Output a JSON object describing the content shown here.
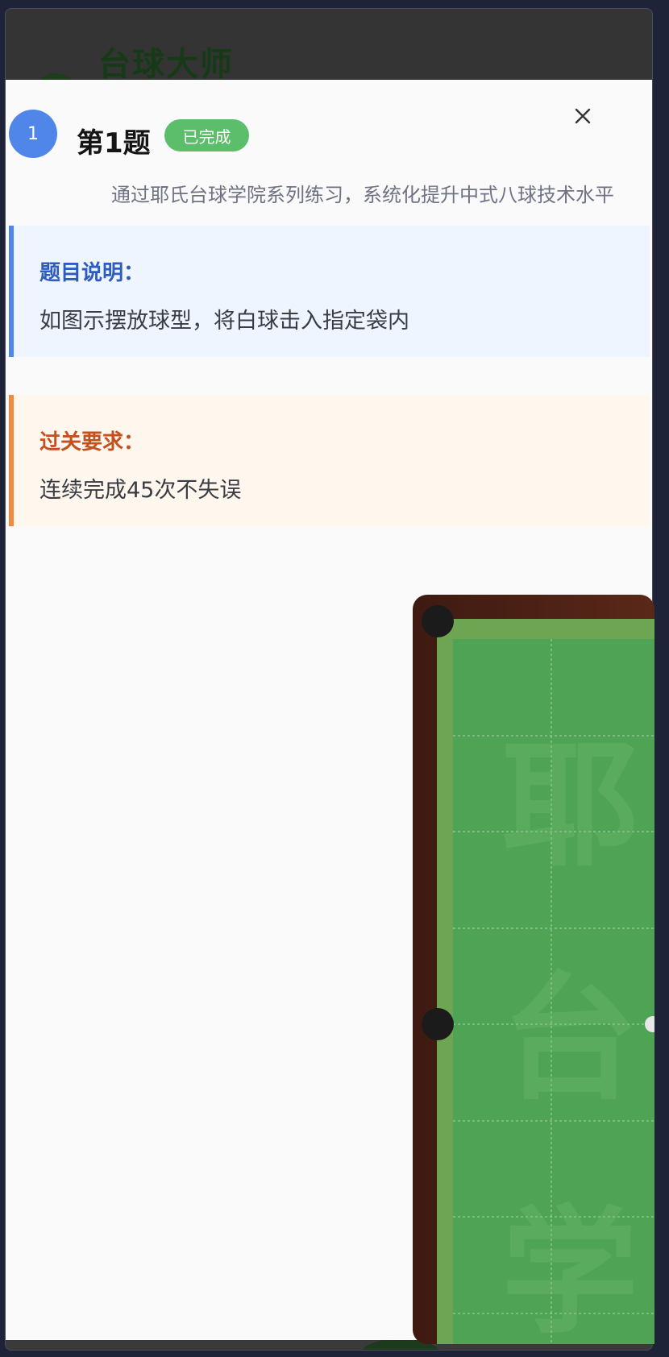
{
  "app": {
    "title": "台球大师"
  },
  "question": {
    "number": "1",
    "title": "第1题",
    "status": "已完成",
    "subtitle": "通过耶氏台球学院系列练习，系统化提升中式八球技术水平"
  },
  "description": {
    "heading": "题目说明：",
    "text": "如图示摆放球型，将白球击入指定袋内"
  },
  "requirement": {
    "heading": "过关要求：",
    "text": "连续完成45次不失误"
  },
  "table": {
    "watermark": [
      "耶",
      "台",
      "学"
    ],
    "colors": {
      "cloth": "#4fa354",
      "rail": "#4a1f14",
      "cushion": "#6ea552",
      "pocket": "#1b1b1b"
    }
  },
  "icons": {
    "close": "close-icon"
  }
}
